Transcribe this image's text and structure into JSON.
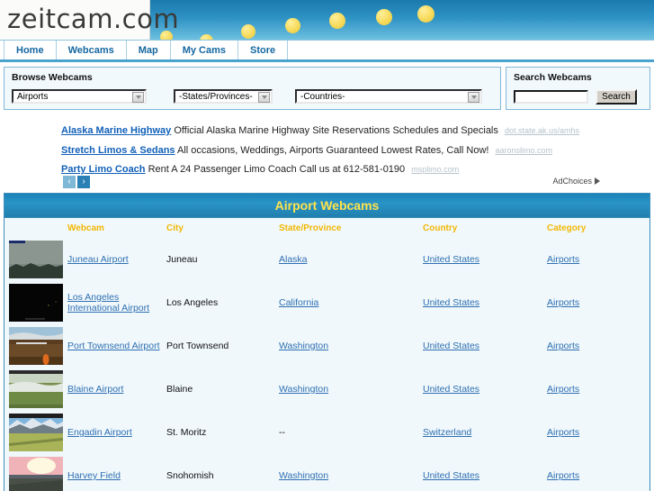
{
  "site": {
    "logo_text": "zeitcam.com"
  },
  "nav": {
    "items": [
      {
        "label": "Home",
        "name": "nav-home"
      },
      {
        "label": "Webcams",
        "name": "nav-webcams"
      },
      {
        "label": "Map",
        "name": "nav-map"
      },
      {
        "label": "My Cams",
        "name": "nav-my-cams"
      },
      {
        "label": "Store",
        "name": "nav-store"
      }
    ]
  },
  "browse": {
    "title": "Browse Webcams",
    "category_select": "Airports",
    "state_select": "-States/Provinces-",
    "country_select": "-Countries-"
  },
  "search": {
    "title": "Search Webcams",
    "input_value": "",
    "placeholder": "",
    "button_label": "Search"
  },
  "ads": {
    "items": [
      {
        "title": "Alaska Marine Highway",
        "text": "Official Alaska Marine Highway Site Reservations Schedules and Specials",
        "url": "dot.state.ak.us/amhs"
      },
      {
        "title": "Stretch Limos & Sedans",
        "text": "All occasions, Weddings, Airports Guaranteed Lowest Rates, Call Now!",
        "url": "aaronslimo.com"
      },
      {
        "title": "Party Limo Coach",
        "text": "Rent A 24 Passenger Limo Coach Call us at 612-581-0190",
        "url": "msplimo.com"
      }
    ],
    "prev_label": "‹",
    "next_label": "›",
    "adchoices_label": "AdChoices"
  },
  "results": {
    "title": "Airport Webcams",
    "columns": [
      "Webcam",
      "City",
      "State/Province",
      "Country",
      "Category"
    ],
    "rows": [
      {
        "webcam": "Juneau Airport",
        "city": "Juneau",
        "state": "Alaska",
        "country": "United States",
        "category": "Airports",
        "thumb": "dusk-forest-thumbnail"
      },
      {
        "webcam": "Los Angeles International Airport",
        "city": "Los Angeles",
        "state": "California",
        "country": "United States",
        "category": "Airports",
        "thumb": "night-dark-thumbnail"
      },
      {
        "webcam": "Port Townsend Airport",
        "city": "Port Townsend",
        "state": "Washington",
        "country": "United States",
        "category": "Airports",
        "thumb": "airfield-brown-thumbnail"
      },
      {
        "webcam": "Blaine Airport",
        "city": "Blaine",
        "state": "Washington",
        "country": "United States",
        "category": "Airports",
        "thumb": "green-field-thumbnail"
      },
      {
        "webcam": "Engadin Airport",
        "city": "St. Moritz",
        "state": "--",
        "country": "Switzerland",
        "category": "Airports",
        "thumb": "alpine-mountain-thumbnail"
      },
      {
        "webcam": "Harvey Field",
        "city": "Snohomish",
        "state": "Washington",
        "country": "United States",
        "category": "Airports",
        "thumb": "sunset-runway-thumbnail"
      }
    ]
  },
  "colors": {
    "banner_blue": "#2e92c4",
    "title_yellow": "#ffe34d",
    "column_header": "#f2b705",
    "link_blue": "#2f6fb0",
    "nav_blue": "#1567a0",
    "table_bg": "#f0f8fc"
  }
}
